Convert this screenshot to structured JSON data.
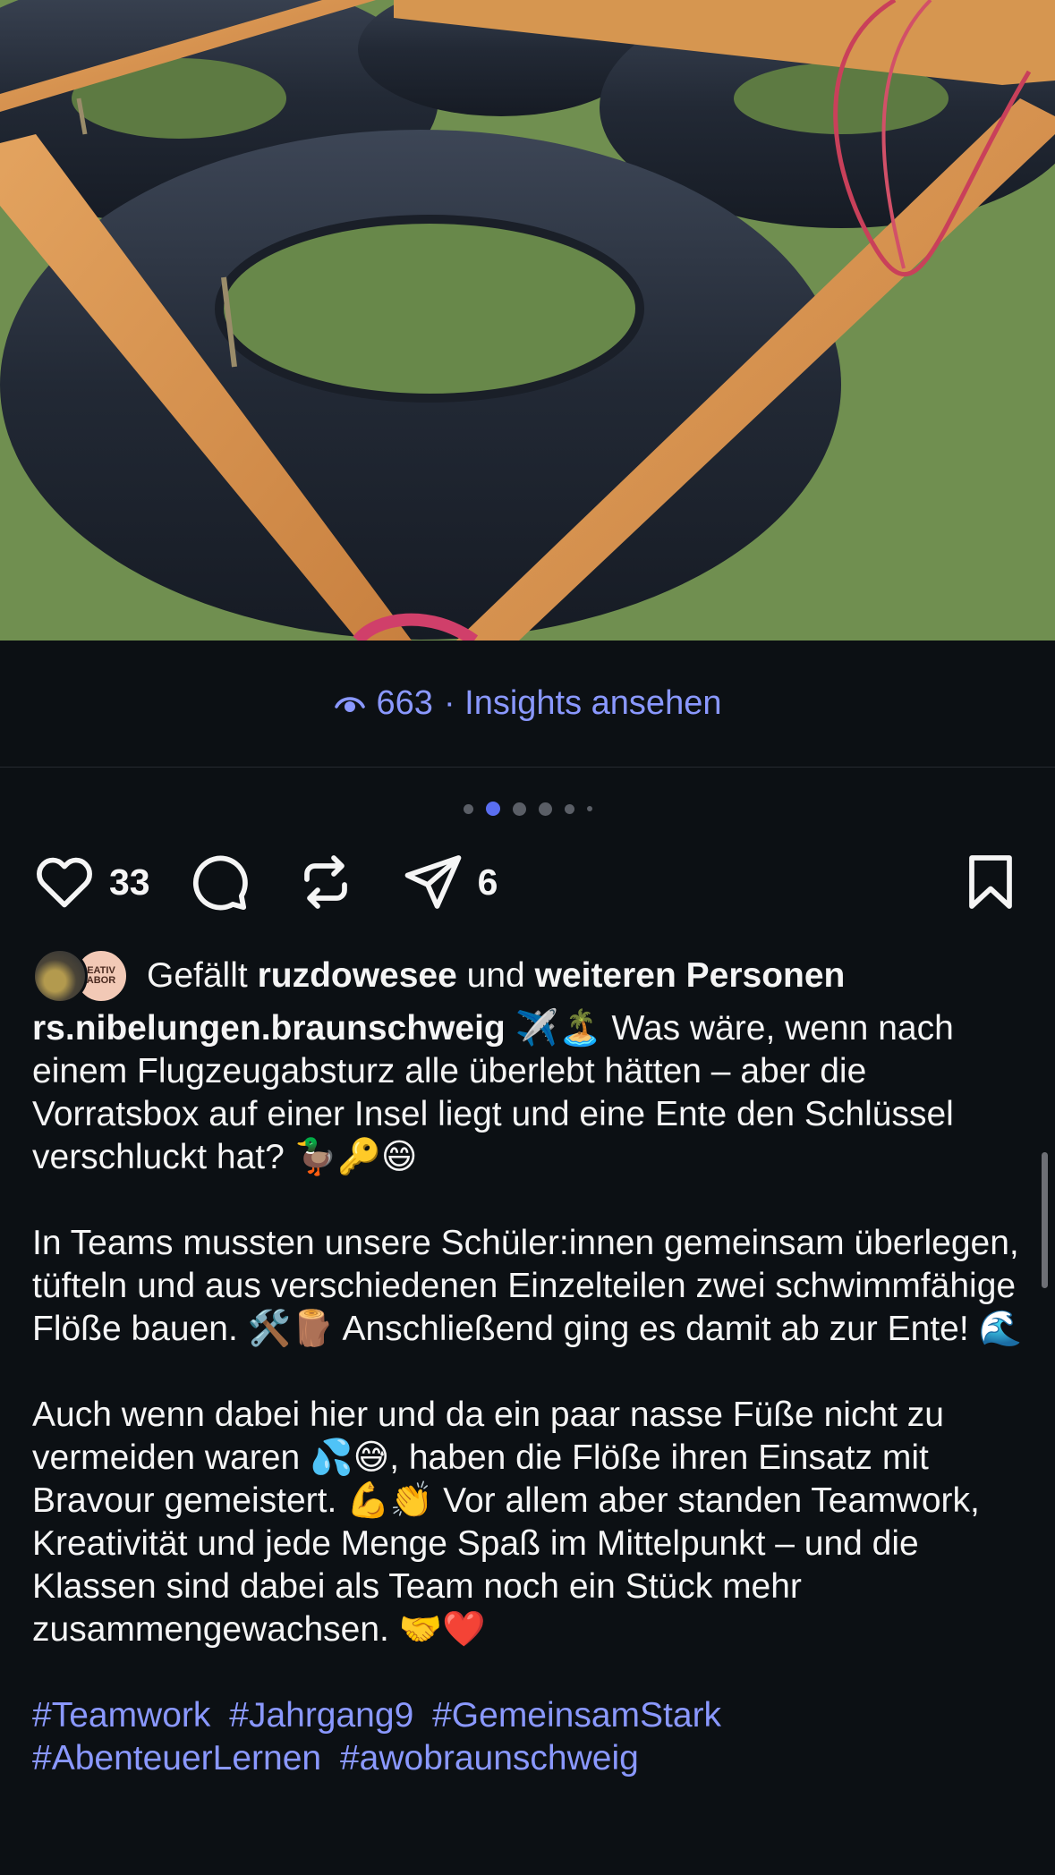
{
  "post": {
    "views": "663",
    "insights_label": "· Insights ansehen",
    "carousel": {
      "count": 6,
      "active_index": 1
    },
    "like_count": "33",
    "share_count": "6",
    "likes": {
      "prefix": "Gefällt",
      "user": "ruzdowesee",
      "conjunction": "und",
      "others": "weiteren Personen",
      "avatar2_text": "EATIV ABOR"
    },
    "author": "rs.nibelungen.braunschweig",
    "caption": {
      "p1": "✈️🏝️ Was wäre, wenn nach einem Flugzeugabsturz alle überlebt hätten – aber die Vorratsbox auf einer Insel liegt und eine Ente den Schlüssel verschluckt hat? 🦆🔑😄",
      "p2": "In Teams mussten unsere Schüler:innen gemeinsam überlegen, tüfteln und aus verschiedenen Einzelteilen zwei schwimmfähige Flöße bauen. 🛠️🪵 Anschließend ging es damit ab zur Ente! 🌊",
      "p3": "Auch wenn dabei hier und da ein paar nasse Füße nicht zu vermeiden waren 💦😅, haben die Flöße ihren Einsatz mit Bravour gemeistert. 💪👏 Vor allem aber standen Teamwork, Kreativität und jede Menge Spaß im Mittelpunkt – und die Klassen sind dabei als Team noch ein Stück mehr zusammengewachsen. 🤝❤️"
    },
    "hashtags": [
      "#Teamwork",
      "#Jahrgang9",
      "#GemeinsamStark",
      "#AbenteuerLernen",
      "#awobraunschweig"
    ]
  },
  "colors": {
    "background": "#0c1014",
    "accent": "#8a98ff",
    "text": "#f5f5f5"
  },
  "icons": [
    "eye-icon",
    "heart-icon",
    "comment-icon",
    "repost-icon",
    "send-icon",
    "bookmark-icon"
  ]
}
